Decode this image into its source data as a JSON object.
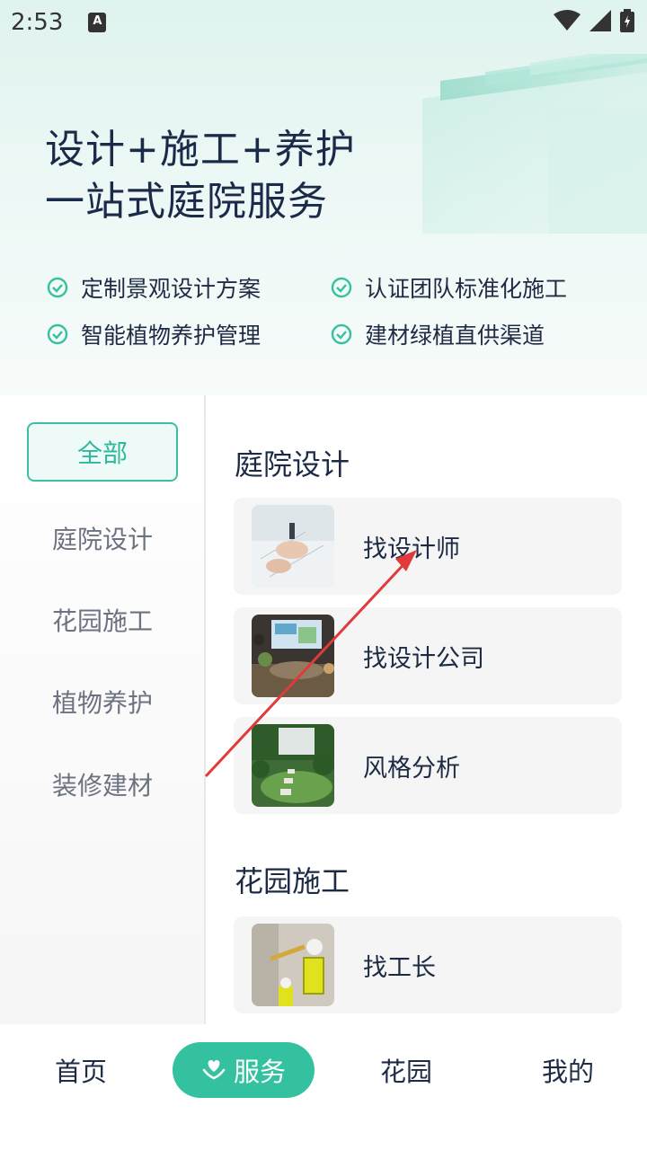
{
  "status_bar": {
    "time": "2:53",
    "notification_icon": "A"
  },
  "hero": {
    "title_line1": "设计+施工+养护",
    "title_line2": "一站式庭院服务",
    "features": [
      "定制景观设计方案",
      "认证团队标准化施工",
      "智能植物养护管理",
      "建材绿植直供渠道"
    ]
  },
  "sidebar": {
    "items": [
      {
        "label": "全部",
        "active": true
      },
      {
        "label": "庭院设计",
        "active": false
      },
      {
        "label": "花园施工",
        "active": false
      },
      {
        "label": "植物养护",
        "active": false
      },
      {
        "label": "装修建材",
        "active": false
      }
    ]
  },
  "sections": [
    {
      "title": "庭院设计",
      "cards": [
        {
          "label": "找设计师",
          "icon": "designer-photo"
        },
        {
          "label": "找设计公司",
          "icon": "company-photo"
        },
        {
          "label": "风格分析",
          "icon": "garden-photo"
        }
      ]
    },
    {
      "title": "花园施工",
      "cards": [
        {
          "label": "找工长",
          "icon": "foreman-photo"
        }
      ]
    }
  ],
  "bottom_nav": {
    "items": [
      {
        "label": "首页",
        "active": false
      },
      {
        "label": "服务",
        "active": true,
        "icon": "heart-hand-icon"
      },
      {
        "label": "花园",
        "active": false
      },
      {
        "label": "我的",
        "active": false
      }
    ]
  },
  "colors": {
    "accent": "#33c19f",
    "arrow": "#e03a3a"
  }
}
